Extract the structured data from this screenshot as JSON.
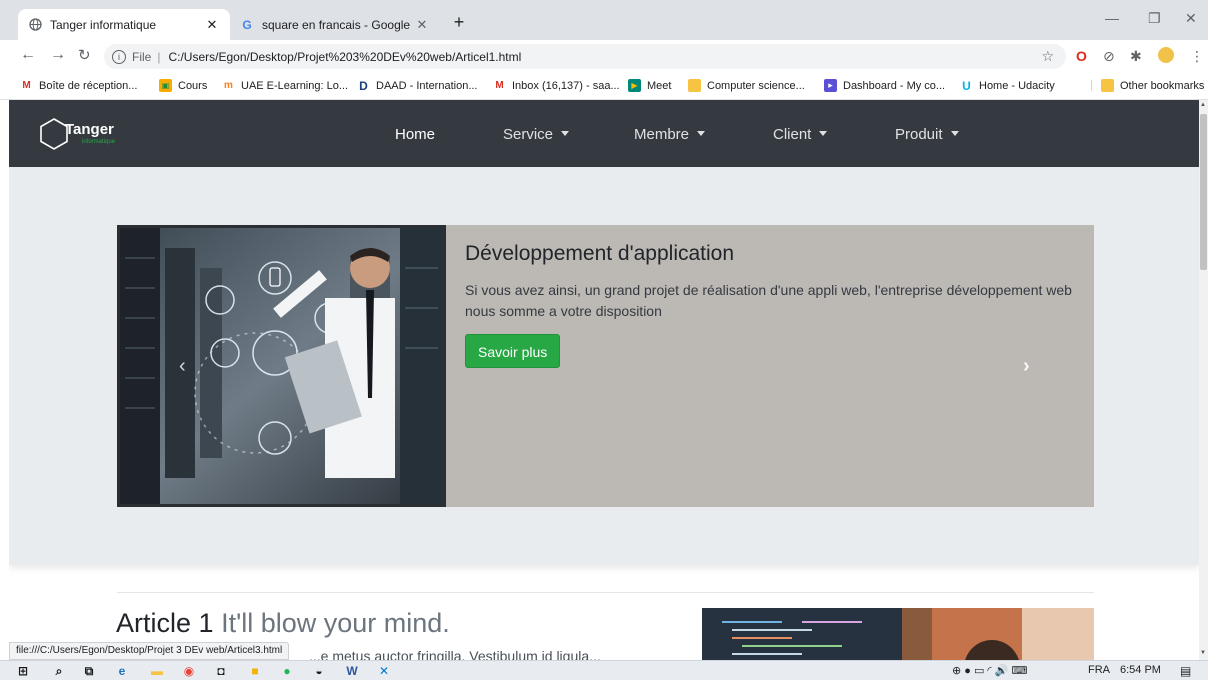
{
  "browser": {
    "tabs": [
      {
        "title": "Tanger informatique",
        "icon": "globe-icon",
        "active": true
      },
      {
        "title": "square en francais - Google Sear",
        "icon": "google-g-icon",
        "active": false
      }
    ],
    "new_tab": "+",
    "url_scheme": "File",
    "url": "C:/Users/Egon/Desktop/Projet%203%20DEv%20web/Articel1.html",
    "bookmarks": [
      {
        "label": "Boîte de réception...",
        "icon": "gmail-icon",
        "color": "#d93025"
      },
      {
        "label": "Cours",
        "icon": "classroom-icon",
        "color": "#f9ab00"
      },
      {
        "label": "UAE E-Learning: Lo...",
        "icon": "moodle-icon",
        "color": "#f98012"
      },
      {
        "label": "DAAD - Internation...",
        "icon": "daad-icon",
        "color": "#1a3f7a"
      },
      {
        "label": "Inbox (16,137) - saa...",
        "icon": "gmail-icon",
        "color": "#d93025"
      },
      {
        "label": "Meet",
        "icon": "meet-icon",
        "color": "#00897b"
      },
      {
        "label": "Computer science...",
        "icon": "folder-icon",
        "color": "#f6c343"
      },
      {
        "label": "Dashboard - My co...",
        "icon": "dashboard-icon",
        "color": "#5b4fd6"
      },
      {
        "label": "Home - Udacity",
        "icon": "udacity-icon",
        "color": "#02b3e4"
      }
    ],
    "other_bookmarks": "Other bookmarks",
    "status_url": "file:///C:/Users/Egon/Desktop/Projet 3 DEv web/Articel3.html"
  },
  "site": {
    "brand": {
      "name": "Tanger",
      "sub": "informatique"
    },
    "nav": [
      {
        "label": "Home",
        "dropdown": false
      },
      {
        "label": "Service",
        "dropdown": true
      },
      {
        "label": "Membre",
        "dropdown": true
      },
      {
        "label": "Client",
        "dropdown": true
      },
      {
        "label": "Produit",
        "dropdown": true
      }
    ],
    "carousel": {
      "title": "Développement d'application",
      "text": "Si vous avez ainsi, un grand projet de réalisation d'une appli web, l'entreprise développement web nous somme a votre disposition",
      "button": "Savoir plus",
      "accent": "#28a745"
    },
    "article": {
      "title": "Article 1",
      "subtitle": "It'll blow your mind.",
      "text_partial": "...e metus auctor fringilla. Vestibulum id ligula..."
    }
  },
  "taskbar": {
    "language": "FRA",
    "time": "6:54 PM"
  },
  "colors": {
    "navbar": "#343a40",
    "jumbotron": "#e9ecef",
    "carousel_bg": "#bcb8b4",
    "button": "#28a745"
  }
}
